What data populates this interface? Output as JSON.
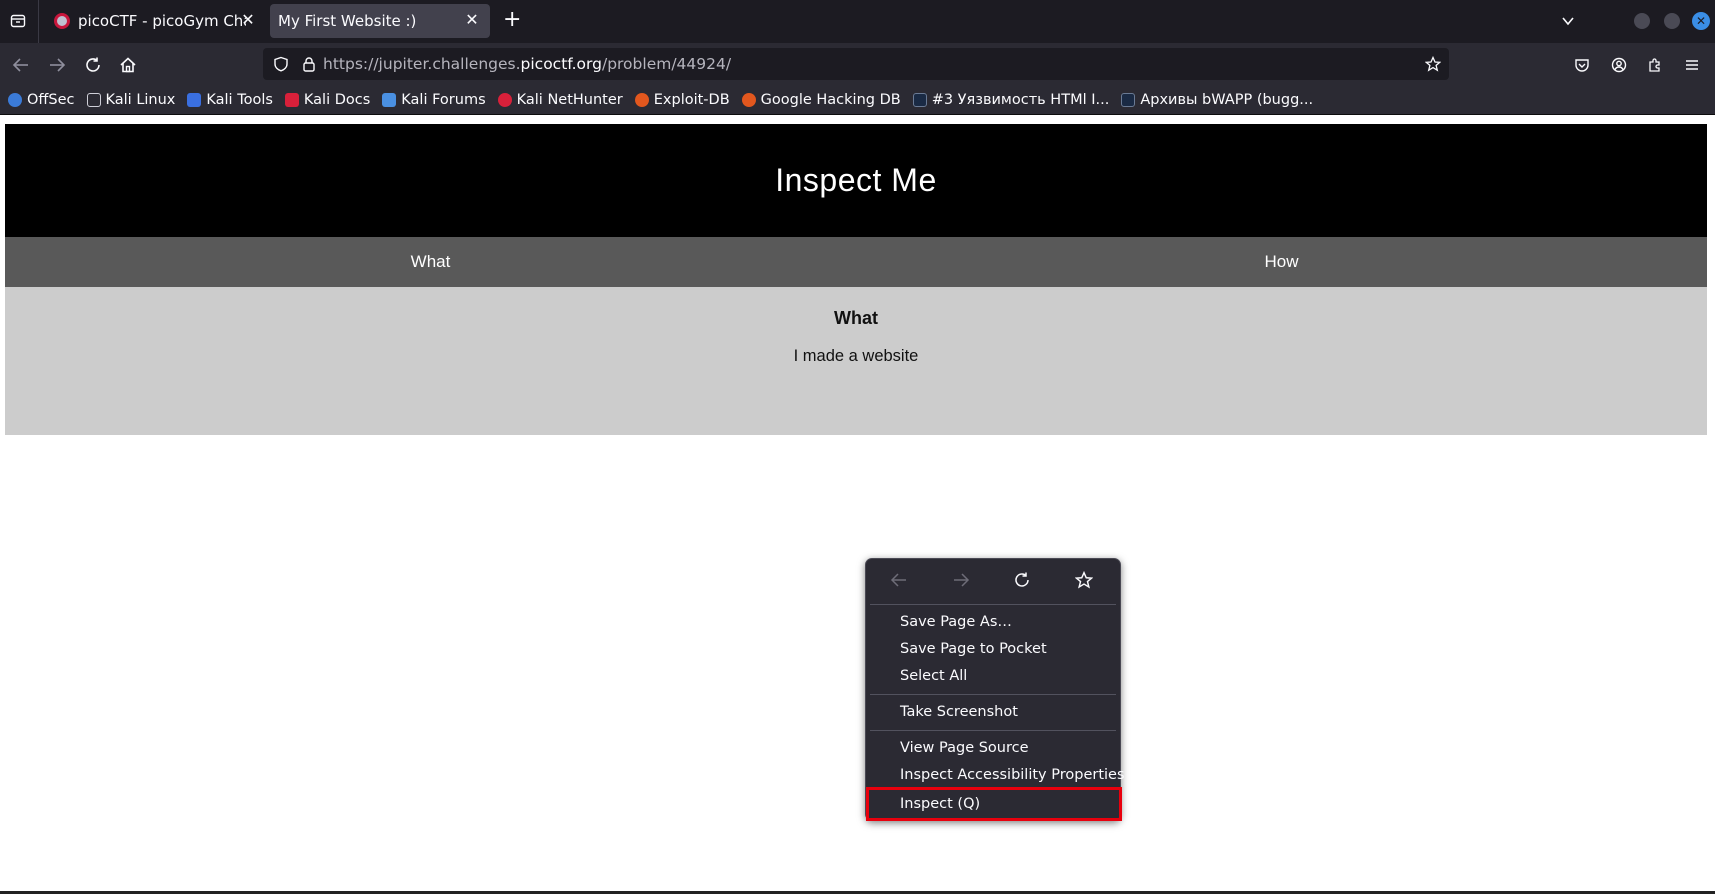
{
  "browser": {
    "tabs": [
      {
        "title": "picoCTF - picoGym Challe",
        "active": false
      },
      {
        "title": "My First Website :)",
        "active": true
      }
    ],
    "new_tab_label": "+",
    "url": {
      "prefix": "https://jupiter.challenges.",
      "host": "picoctf.org",
      "path": "/problem/44924/"
    },
    "bookmarks": [
      {
        "label": "OffSec",
        "color": "#3b7bd8"
      },
      {
        "label": "Kali Linux",
        "color": "#2b2a33"
      },
      {
        "label": "Kali Tools",
        "color": "#3a6fe0"
      },
      {
        "label": "Kali Docs",
        "color": "#d8203a"
      },
      {
        "label": "Kali Forums",
        "color": "#4a90e2"
      },
      {
        "label": "Kali NetHunter",
        "color": "#d8203a"
      },
      {
        "label": "Exploit-DB",
        "color": "#e2571e"
      },
      {
        "label": "Google Hacking DB",
        "color": "#e2571e"
      },
      {
        "label": "#3 Уязвимость HTMl I...",
        "color": "#1a2a44"
      },
      {
        "label": "Архивы bWAPP (bugg...",
        "color": "#1a2a44"
      }
    ]
  },
  "site": {
    "header_title": "Inspect Me",
    "tabs": [
      "What",
      "How"
    ],
    "content_heading": "What",
    "content_text": "I made a website"
  },
  "context_menu": {
    "items": [
      {
        "label": "Save Page As…",
        "group": 1
      },
      {
        "label": "Save Page to Pocket",
        "group": 1
      },
      {
        "label": "Select All",
        "group": 1
      },
      {
        "label": "Take Screenshot",
        "group": 2
      },
      {
        "label": "View Page Source",
        "group": 3
      },
      {
        "label": "Inspect Accessibility Properties",
        "group": 3
      },
      {
        "label": "Inspect (Q)",
        "group": 3,
        "highlighted": true
      }
    ],
    "highlight_color": "#e8000d"
  }
}
